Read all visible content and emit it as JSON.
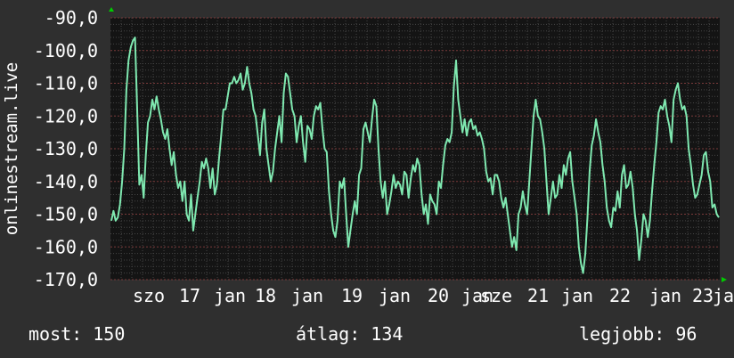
{
  "chart_data": {
    "type": "line",
    "ylabel": "onlinestream.live",
    "ylim": [
      -170,
      -90
    ],
    "y_ticks": [
      -90,
      -100,
      -110,
      -120,
      -130,
      -140,
      -150,
      -160,
      -170
    ],
    "y_tick_labels": [
      "-90,0",
      "-100,0",
      "-110,0",
      "-120,0",
      "-130,0",
      "-140,0",
      "-150,0",
      "-160,0",
      "-170,0"
    ],
    "x_tick_labels": [
      "szo",
      "17",
      "jan",
      "18",
      "jan",
      "19",
      "jan",
      "20",
      "jan",
      "sze",
      "21",
      "jan",
      "22",
      "jan",
      "23",
      "jan"
    ],
    "grid": true,
    "colors": {
      "line": "#7fe8b0",
      "grid_major": "#7a3a3a",
      "grid_minor": "#444444",
      "axis_arrow": "#00cc00",
      "plot_bg": "#141414"
    },
    "series": [
      {
        "values": [
          -152,
          -149,
          -152,
          -151,
          -147,
          -140,
          -130,
          -112,
          -103,
          -99,
          -97,
          -96,
          -118,
          -141,
          -138,
          -145,
          -132,
          -122,
          -120,
          -115,
          -118,
          -114,
          -118,
          -121,
          -125,
          -127,
          -124,
          -130,
          -135,
          -131,
          -138,
          -142,
          -140,
          -146,
          -140,
          -150,
          -152,
          -144,
          -155,
          -150,
          -145,
          -140,
          -134,
          -136,
          -133,
          -136,
          -142,
          -136,
          -144,
          -141,
          -133,
          -126,
          -118,
          -118,
          -114,
          -110,
          -110,
          -108,
          -110,
          -109,
          -107,
          -112,
          -110,
          -105,
          -110,
          -113,
          -118,
          -120,
          -126,
          -132,
          -122,
          -118,
          -130,
          -135,
          -140,
          -137,
          -130,
          -125,
          -120,
          -128,
          -113,
          -107,
          -108,
          -113,
          -118,
          -120,
          -128,
          -123,
          -120,
          -128,
          -134,
          -123,
          -124,
          -127,
          -120,
          -117,
          -118,
          -116,
          -124,
          -130,
          -131,
          -143,
          -150,
          -155,
          -157,
          -152,
          -140,
          -142,
          -139,
          -150,
          -160,
          -155,
          -150,
          -146,
          -150,
          -138,
          -136,
          -124,
          -122,
          -125,
          -128,
          -121,
          -115,
          -117,
          -130,
          -140,
          -145,
          -140,
          -150,
          -147,
          -143,
          -138,
          -142,
          -140,
          -141,
          -144,
          -137,
          -138,
          -145,
          -139,
          -135,
          -137,
          -133,
          -135,
          -144,
          -150,
          -147,
          -153,
          -144,
          -146,
          -147,
          -150,
          -140,
          -142,
          -135,
          -129,
          -127,
          -128,
          -125,
          -111,
          -103,
          -115,
          -120,
          -125,
          -121,
          -126,
          -122,
          -121,
          -124,
          -123,
          -126,
          -125,
          -127,
          -130,
          -137,
          -140,
          -139,
          -144,
          -138,
          -138,
          -140,
          -145,
          -148,
          -145,
          -150,
          -155,
          -160,
          -157,
          -161,
          -150,
          -148,
          -143,
          -147,
          -150,
          -140,
          -130,
          -120,
          -115,
          -120,
          -121,
          -125,
          -130,
          -140,
          -150,
          -145,
          -140,
          -145,
          -144,
          -138,
          -142,
          -135,
          -138,
          -133,
          -131,
          -140,
          -145,
          -150,
          -160,
          -165,
          -168,
          -162,
          -151,
          -137,
          -129,
          -126,
          -121,
          -125,
          -128,
          -135,
          -140,
          -148,
          -152,
          -154,
          -148,
          -149,
          -143,
          -148,
          -138,
          -135,
          -142,
          -141,
          -137,
          -142,
          -150,
          -155,
          -164,
          -158,
          -150,
          -152,
          -157,
          -152,
          -143,
          -135,
          -128,
          -119,
          -117,
          -118,
          -115,
          -120,
          -123,
          -128,
          -115,
          -112,
          -110,
          -115,
          -118,
          -117,
          -120,
          -130,
          -135,
          -141,
          -145,
          -144,
          -141,
          -138,
          -132,
          -131,
          -137,
          -140,
          -148,
          -147,
          -150,
          -151
        ]
      }
    ]
  },
  "footer": {
    "current": "most: 150",
    "average": "átlag: 134",
    "best": "legjobb: 96"
  }
}
